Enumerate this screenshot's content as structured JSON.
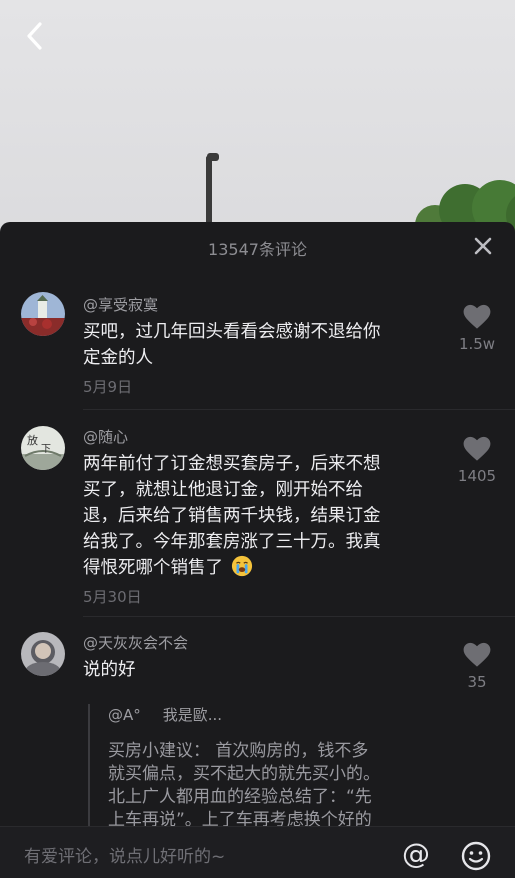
{
  "panel": {
    "comment_count": "13547条评论"
  },
  "comments": [
    {
      "username": "@享受寂寞",
      "text": [
        "买吧，过几年回头看看会感谢不退给你",
        "定金的人"
      ],
      "date": "5月9日",
      "likes": "1.5w"
    },
    {
      "username": "@随心",
      "text": [
        "两年前付了订金想买套房子，后来不想",
        "买了，就想让他退订金，刚开始不给",
        "退，后来给了销售两千块钱，结果订金",
        "给我了。今年那套房涨了三十万。我真",
        "得恨死哪个销售了"
      ],
      "date": "5月30日",
      "likes": "1405"
    },
    {
      "username": "@天灰灰会不会",
      "text": [
        "说的好"
      ],
      "likes": "35"
    }
  ],
  "reply": {
    "handle": "@A°",
    "name": "我是歐...",
    "text": [
      "买房小建议： 首次购房的，钱不多",
      "就买偏点，买不起大的就先买小的。",
      "北上广人都用血的经验总结了：“先",
      "上车再说”。上了车再考虑换个好的"
    ]
  },
  "bottom": {
    "input_placeholder": "有爱评论，说点儿好听的~",
    "at_symbol": "@"
  },
  "colors": {
    "panel_bg": "#1b1b1d",
    "text_primary": "#ededf0",
    "text_secondary": "#9d9da2",
    "heart": "#6e6e73"
  },
  "icons": [
    "back-arrow-icon",
    "close-icon",
    "heart-icon",
    "crying-emoji-icon",
    "at-icon",
    "emoji-smile-icon"
  ]
}
